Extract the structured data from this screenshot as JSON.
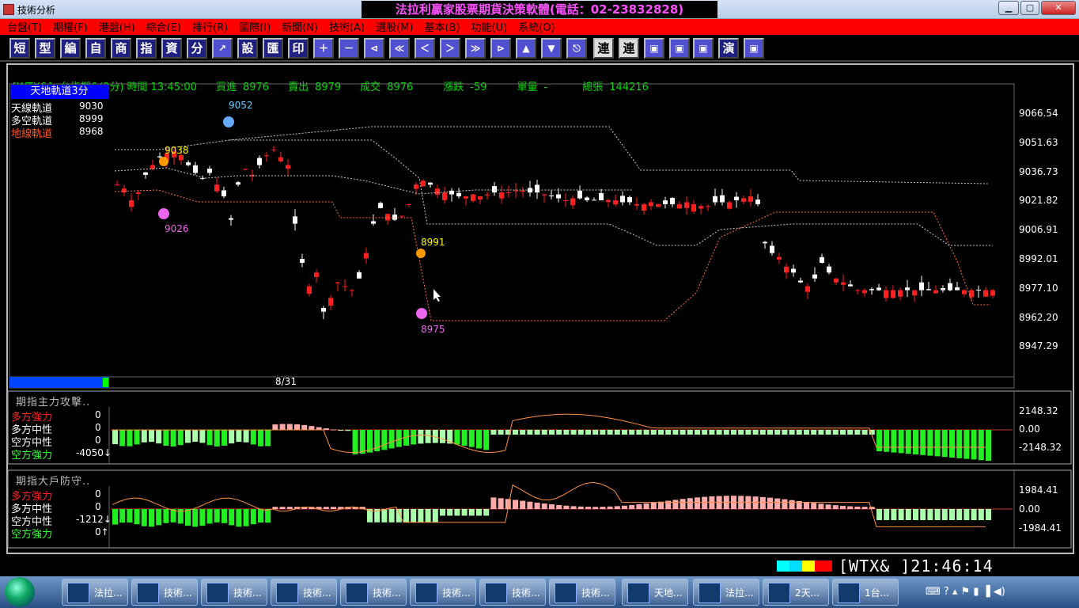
{
  "window": {
    "title": "技術分析",
    "banner": "法拉利贏家股票期貨決策軟體(電話：02-23832828)"
  },
  "menu": [
    "台盤(T)",
    "期權(F)",
    "港盤(H)",
    "綜合(E)",
    "排行(R)",
    "國際(I)",
    "新聞(N)",
    "技術(A)",
    "選股(M)",
    "基本(B)",
    "功能(U)",
    "系統(O)"
  ],
  "toolbar": {
    "text_buttons": [
      "短",
      "型",
      "編",
      "自",
      "商",
      "指",
      "資",
      "分"
    ],
    "text_buttons2": [
      "設",
      "匯",
      "印"
    ],
    "end_buttons": [
      "連",
      "連",
      "演"
    ]
  },
  "quote": {
    "symbol": "[WTX&]",
    "name": "台指期&(3分)",
    "time_label": "時間",
    "time": "13:45:00",
    "bid_label": "買進",
    "bid": "8976",
    "ask_label": "賣出",
    "ask": "8979",
    "last_label": "成交",
    "last": "8976",
    "chg_label": "漲跌",
    "chg": "-59",
    "vol_label": "單量",
    "vol": "-",
    "total_label": "總張",
    "total": "144216"
  },
  "main_panel": {
    "title": "天地軌道3分",
    "rows": [
      {
        "label": "天線軌道",
        "value": "9030",
        "color": "#ffffff"
      },
      {
        "label": "多空軌道",
        "value": "8999",
        "color": "#ffffff"
      },
      {
        "label": "地線軌道",
        "value": "8968",
        "color": "#ff5522"
      }
    ],
    "yticks": [
      "9066.54",
      "9051.63",
      "9036.73",
      "9021.82",
      "9006.91",
      "8992.01",
      "8977.10",
      "8962.20",
      "8947.29"
    ],
    "date": "8/31",
    "annotations": {
      "high": "9052",
      "low1": "9026",
      "low2": "8975",
      "mark1": "8991",
      "mark2": "9038"
    }
  },
  "sub1": {
    "title": "期指主力攻擊..",
    "rows": [
      {
        "label": "多方強力",
        "value": "0",
        "color": "#ff2222"
      },
      {
        "label": "多方中性",
        "value": "0",
        "color": "#ffffff"
      },
      {
        "label": "空方中性",
        "value": "0",
        "color": "#ffffff"
      },
      {
        "label": "空方強力",
        "value": "-4050↓",
        "color": "#33ff33"
      }
    ],
    "yticks": [
      "2148.32",
      "0.00",
      "-2148.32"
    ]
  },
  "sub2": {
    "title": "期指大戶防守..",
    "rows": [
      {
        "label": "多方強力",
        "value": "0",
        "color": "#ff2222"
      },
      {
        "label": "多方中性",
        "value": "0",
        "color": "#ffffff"
      },
      {
        "label": "空方中性",
        "value": "-1212↓",
        "color": "#ffffff"
      },
      {
        "label": "空方強力",
        "value": "0↑",
        "color": "#33ff33"
      }
    ],
    "yticks": [
      "1984.41",
      "0.00",
      "-1984.41"
    ]
  },
  "status": {
    "ticker": "[WTX&  ]21:46:14"
  },
  "taskbar": {
    "tasks": [
      "法拉...",
      "技術...",
      "技術...",
      "技術...",
      "技術...",
      "技術...",
      "技術...",
      "技術...",
      "天地...",
      "法拉...",
      "2天...",
      "1台..."
    ]
  }
}
